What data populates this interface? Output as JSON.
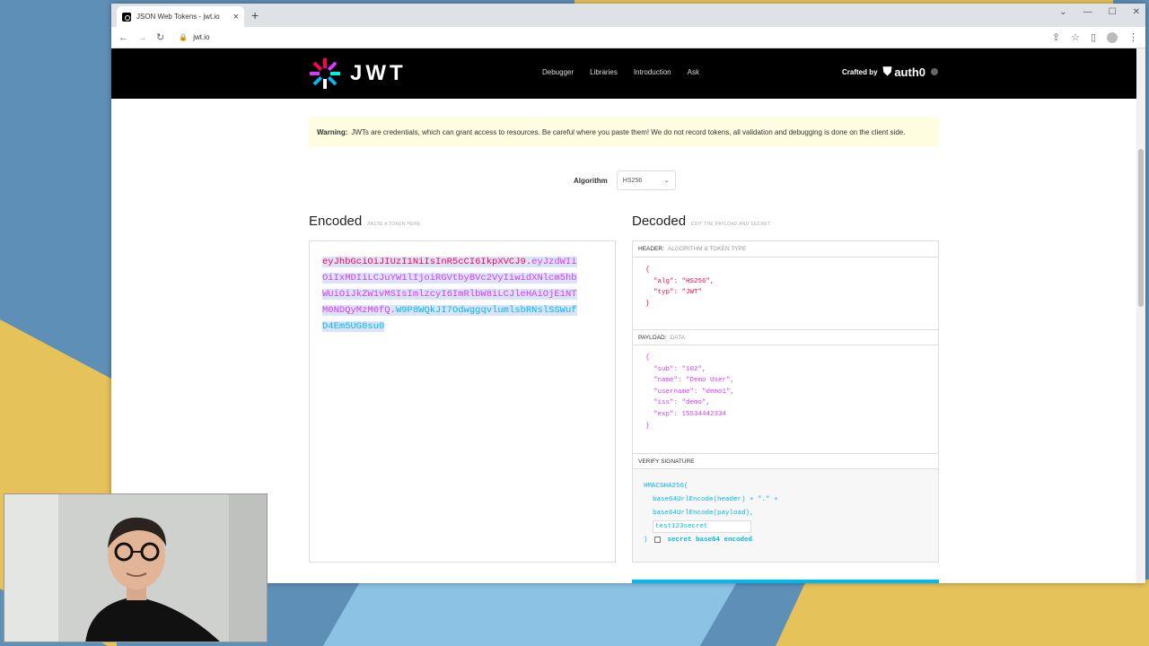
{
  "browser": {
    "tab_title": "JSON Web Tokens - jwt.io",
    "url": "jwt.io"
  },
  "nav": {
    "logo_text": "JWT",
    "links": [
      "Debugger",
      "Libraries",
      "Introduction",
      "Ask"
    ],
    "crafted_by": "Crafted by",
    "auth0": "auth0"
  },
  "warning": {
    "label": "Warning:",
    "text": "JWTs are credentials, which can grant access to resources. Be careful where you paste them! We do not record tokens, all validation and debugging is done on the client side."
  },
  "algorithm": {
    "label": "Algorithm",
    "value": "HS256"
  },
  "encoded": {
    "title": "Encoded",
    "subtitle": "PASTE A TOKEN HERE",
    "header_part": "eyJhbGciOiJIUzI1NiIsInR5cCI6IkpXVCJ9",
    "payload_part": "eyJzdWIiOiIxMDIiLCJuYW1lIjoiRGVtbyBVc2VyIiwidXNlcm5hbWUiOiJkZW1vMSIsImlzcyI6ImRlbW8iLCJleHAiOjE1NTM0NDQyMzM0fQ",
    "signature_part": "W9P8WQkJI7OdwggqvlumlsbRNslSSWufD4Em5UG0su0"
  },
  "decoded": {
    "title": "Decoded",
    "subtitle": "EDIT THE PAYLOAD AND SECRET",
    "header_label": "HEADER:",
    "header_sub": "ALGORITHM & TOKEN TYPE",
    "header_lines": [
      "{",
      "  \"alg\": \"HS256\",",
      "  \"typ\": \"JWT\"",
      "}"
    ],
    "payload_label": "PAYLOAD:",
    "payload_sub": "DATA",
    "payload_lines": [
      "{",
      "  \"sub\": \"102\",",
      "  \"name\": \"Demo User\",",
      "  \"username\": \"demo1\",",
      "  \"iss\": \"demo\",",
      "  \"exp\": 15534442334",
      "}"
    ],
    "verify_label": "VERIFY SIGNATURE",
    "sig_line1": "HMACSHA256(",
    "sig_line2": "base64UrlEncode(header) + \".\" +",
    "sig_line3": "base64UrlEncode(payload),",
    "secret_value": "test123secret",
    "sig_close": ")",
    "secret_check_label": "secret base64 encoded"
  },
  "colors": {
    "red": "#fb015b",
    "purple": "#d63aff",
    "blue": "#00b9f1"
  }
}
